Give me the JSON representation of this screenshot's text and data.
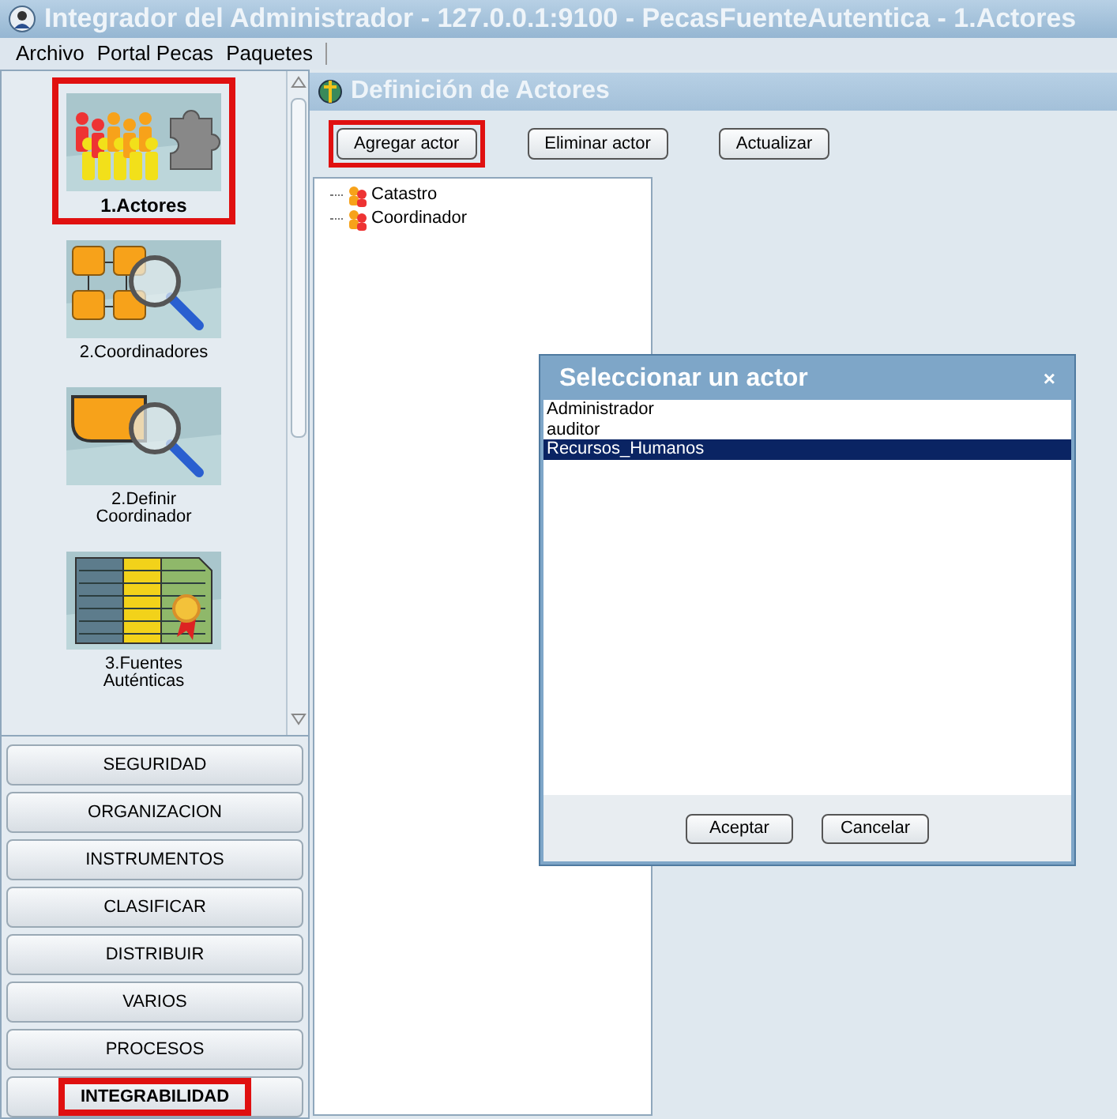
{
  "window": {
    "title": "Integrador del Administrador - 127.0.0.1:9100 - PecasFuenteAutentica - 1.Actores"
  },
  "menu": [
    "Archivo",
    "Portal Pecas",
    "Paquetes"
  ],
  "sidebar": {
    "items": [
      {
        "label": "1.Actores",
        "kind": "actors",
        "selected": true,
        "highlighted": true
      },
      {
        "label": "2.Coordinadores",
        "kind": "coordinators",
        "selected": false,
        "highlighted": false
      },
      {
        "label": "2.Definir Coordinador",
        "kind": "define",
        "selected": false,
        "highlighted": false
      },
      {
        "label": "3.Fuentes Auténticas",
        "kind": "sources",
        "selected": false,
        "highlighted": false
      }
    ],
    "sections": [
      {
        "label": "SEGURIDAD",
        "selected": false,
        "highlighted": false
      },
      {
        "label": "ORGANIZACION",
        "selected": false,
        "highlighted": false
      },
      {
        "label": "INSTRUMENTOS",
        "selected": false,
        "highlighted": false
      },
      {
        "label": "CLASIFICAR",
        "selected": false,
        "highlighted": false
      },
      {
        "label": "DISTRIBUIR",
        "selected": false,
        "highlighted": false
      },
      {
        "label": "VARIOS",
        "selected": false,
        "highlighted": false
      },
      {
        "label": "PROCESOS",
        "selected": false,
        "highlighted": false
      },
      {
        "label": "INTEGRABILIDAD",
        "selected": true,
        "highlighted": true
      }
    ]
  },
  "panel": {
    "title": "Definición de Actores",
    "toolbar": [
      {
        "label": "Agregar actor",
        "highlighted": true
      },
      {
        "label": "Eliminar actor",
        "highlighted": false
      },
      {
        "label": "Actualizar",
        "highlighted": false
      }
    ],
    "tree": [
      "Catastro",
      "Coordinador"
    ]
  },
  "dialog": {
    "title": "Seleccionar un actor",
    "close": "×",
    "items": [
      {
        "label": "Administrador",
        "selected": false
      },
      {
        "label": "auditor",
        "selected": false
      },
      {
        "label": "Recursos_Humanos",
        "selected": true
      }
    ],
    "buttons": [
      "Aceptar",
      "Cancelar"
    ]
  }
}
